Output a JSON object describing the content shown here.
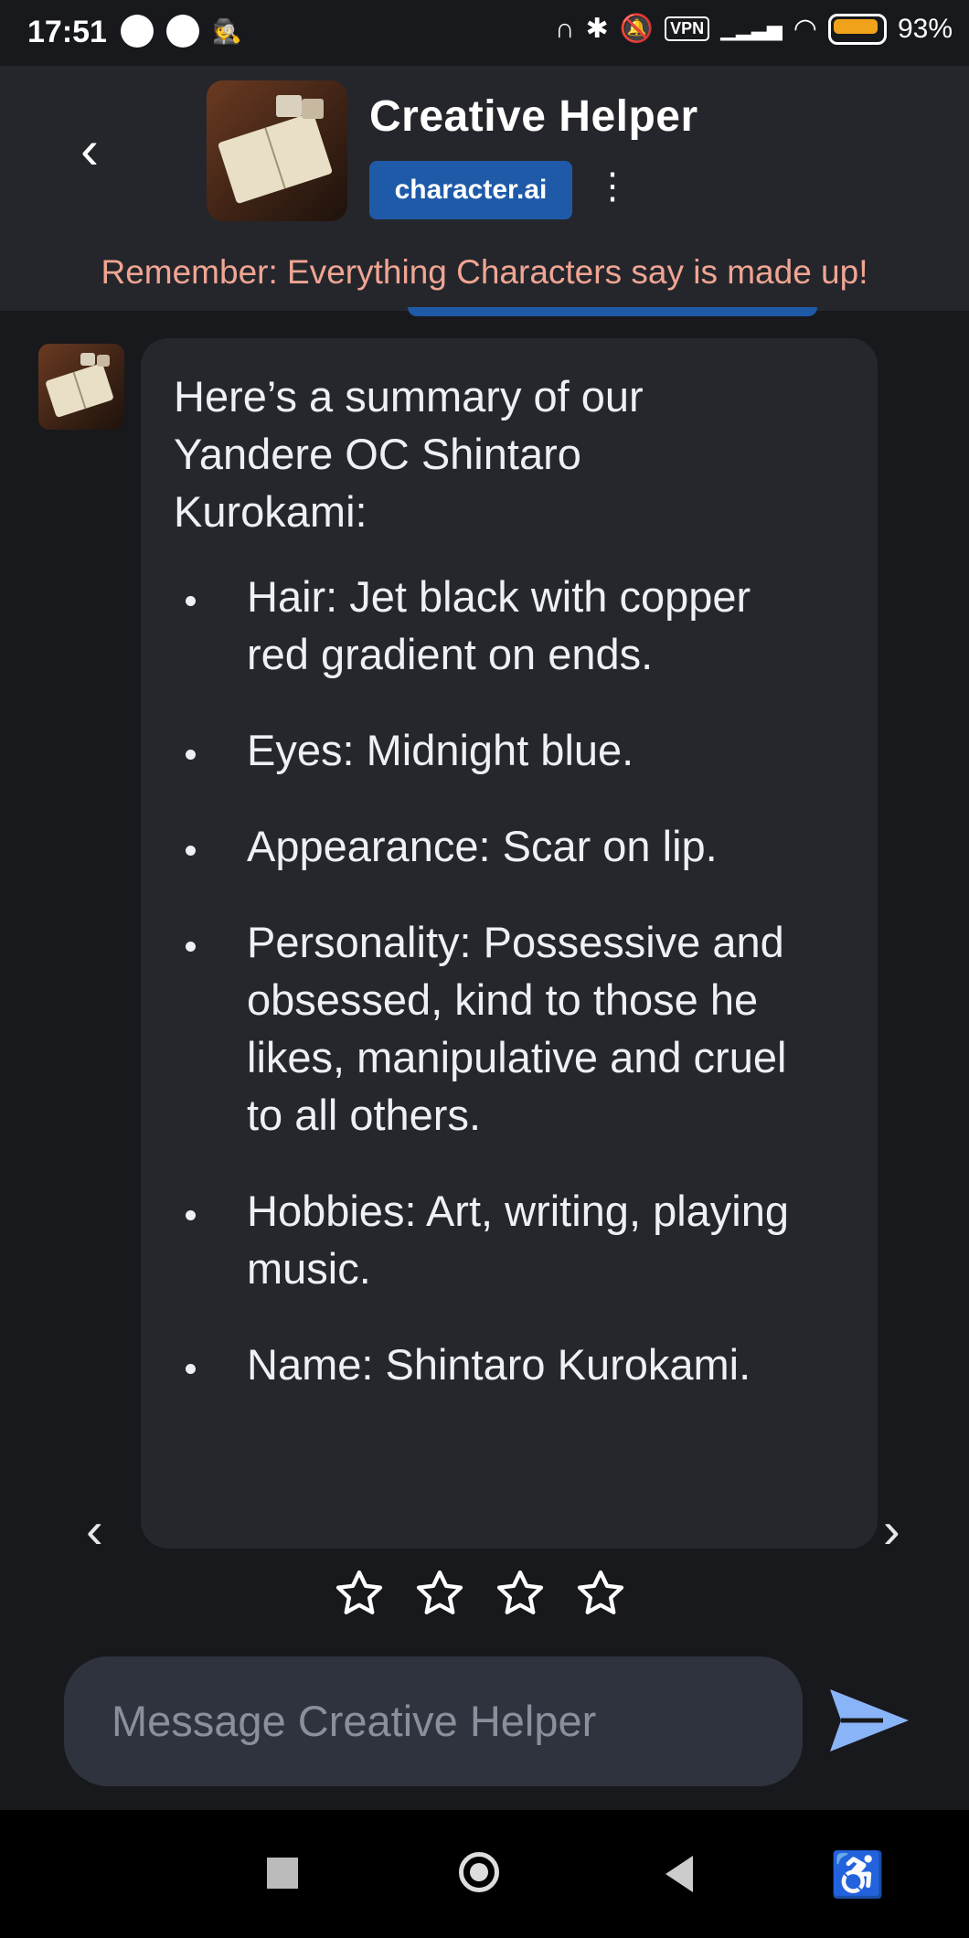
{
  "status_bar": {
    "time": "17:51",
    "vpn": "VPN",
    "battery": "93%",
    "icons_left": [
      "spotify-icon",
      "app-icon",
      "incognito-icon"
    ],
    "icons_right": [
      "headphones-icon",
      "bluetooth-icon",
      "silent-bell-icon",
      "vpn-icon",
      "signal-icon",
      "wifi-icon",
      "battery-icon"
    ]
  },
  "header": {
    "title": "Creative Helper",
    "badge": "character.ai"
  },
  "disclaimer": "Remember: Everything Characters say is made up!",
  "message": {
    "intro": "Here’s a summary of our Yandere OC Shintaro Kurokami:",
    "items": [
      "Hair: Jet black with copper red gradient on ends.",
      "Eyes: Midnight blue.",
      "Appearance: Scar on lip.",
      "Personality: Possessive and obsessed, kind to those he likes, manipulative and cruel to all others.",
      "Hobbies: Art, writing, playing music.",
      "Name: Shintaro Kurokami."
    ]
  },
  "rating": {
    "max": 4,
    "value": 0
  },
  "composer": {
    "placeholder": "Message Creative Helper"
  },
  "colors": {
    "background": "#18191c",
    "header": "#25262b",
    "bubble": "#26272c",
    "badge": "#1e5aa8",
    "disclaimer": "#f0a593",
    "send": "#8ab4f8"
  }
}
